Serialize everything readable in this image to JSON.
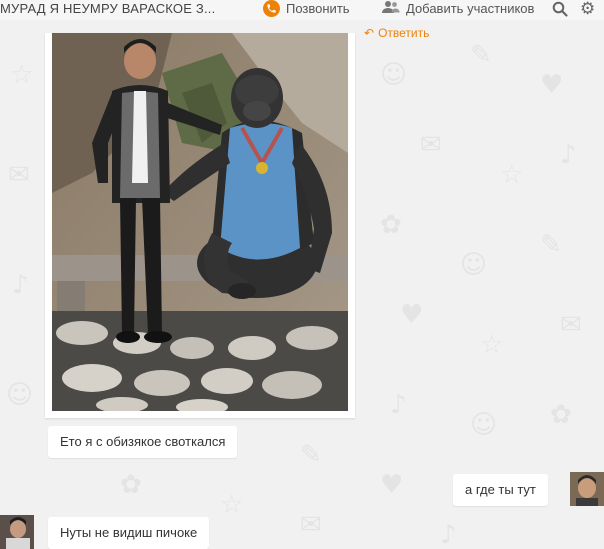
{
  "header": {
    "chat_title": "МУРАД Я НЕУМРУ ВАРАСКОЕ З...",
    "call_label": "Позвонить",
    "add_participants_label": "Добавить участников"
  },
  "reply_label": "Ответить",
  "messages": [
    {
      "text": "Ето я с обизякое своткался"
    },
    {
      "text": "а где ты тут"
    },
    {
      "text": "Нуты не видиш пичоке"
    }
  ],
  "colors": {
    "accent": "#ee8208",
    "background": "#f1f1f1",
    "bubble": "#ffffff"
  },
  "icons": {
    "call": "phone-icon",
    "add": "add-people-icon",
    "search": "search-icon",
    "settings": "gear-icon",
    "reply": "reply-arrow-icon"
  }
}
